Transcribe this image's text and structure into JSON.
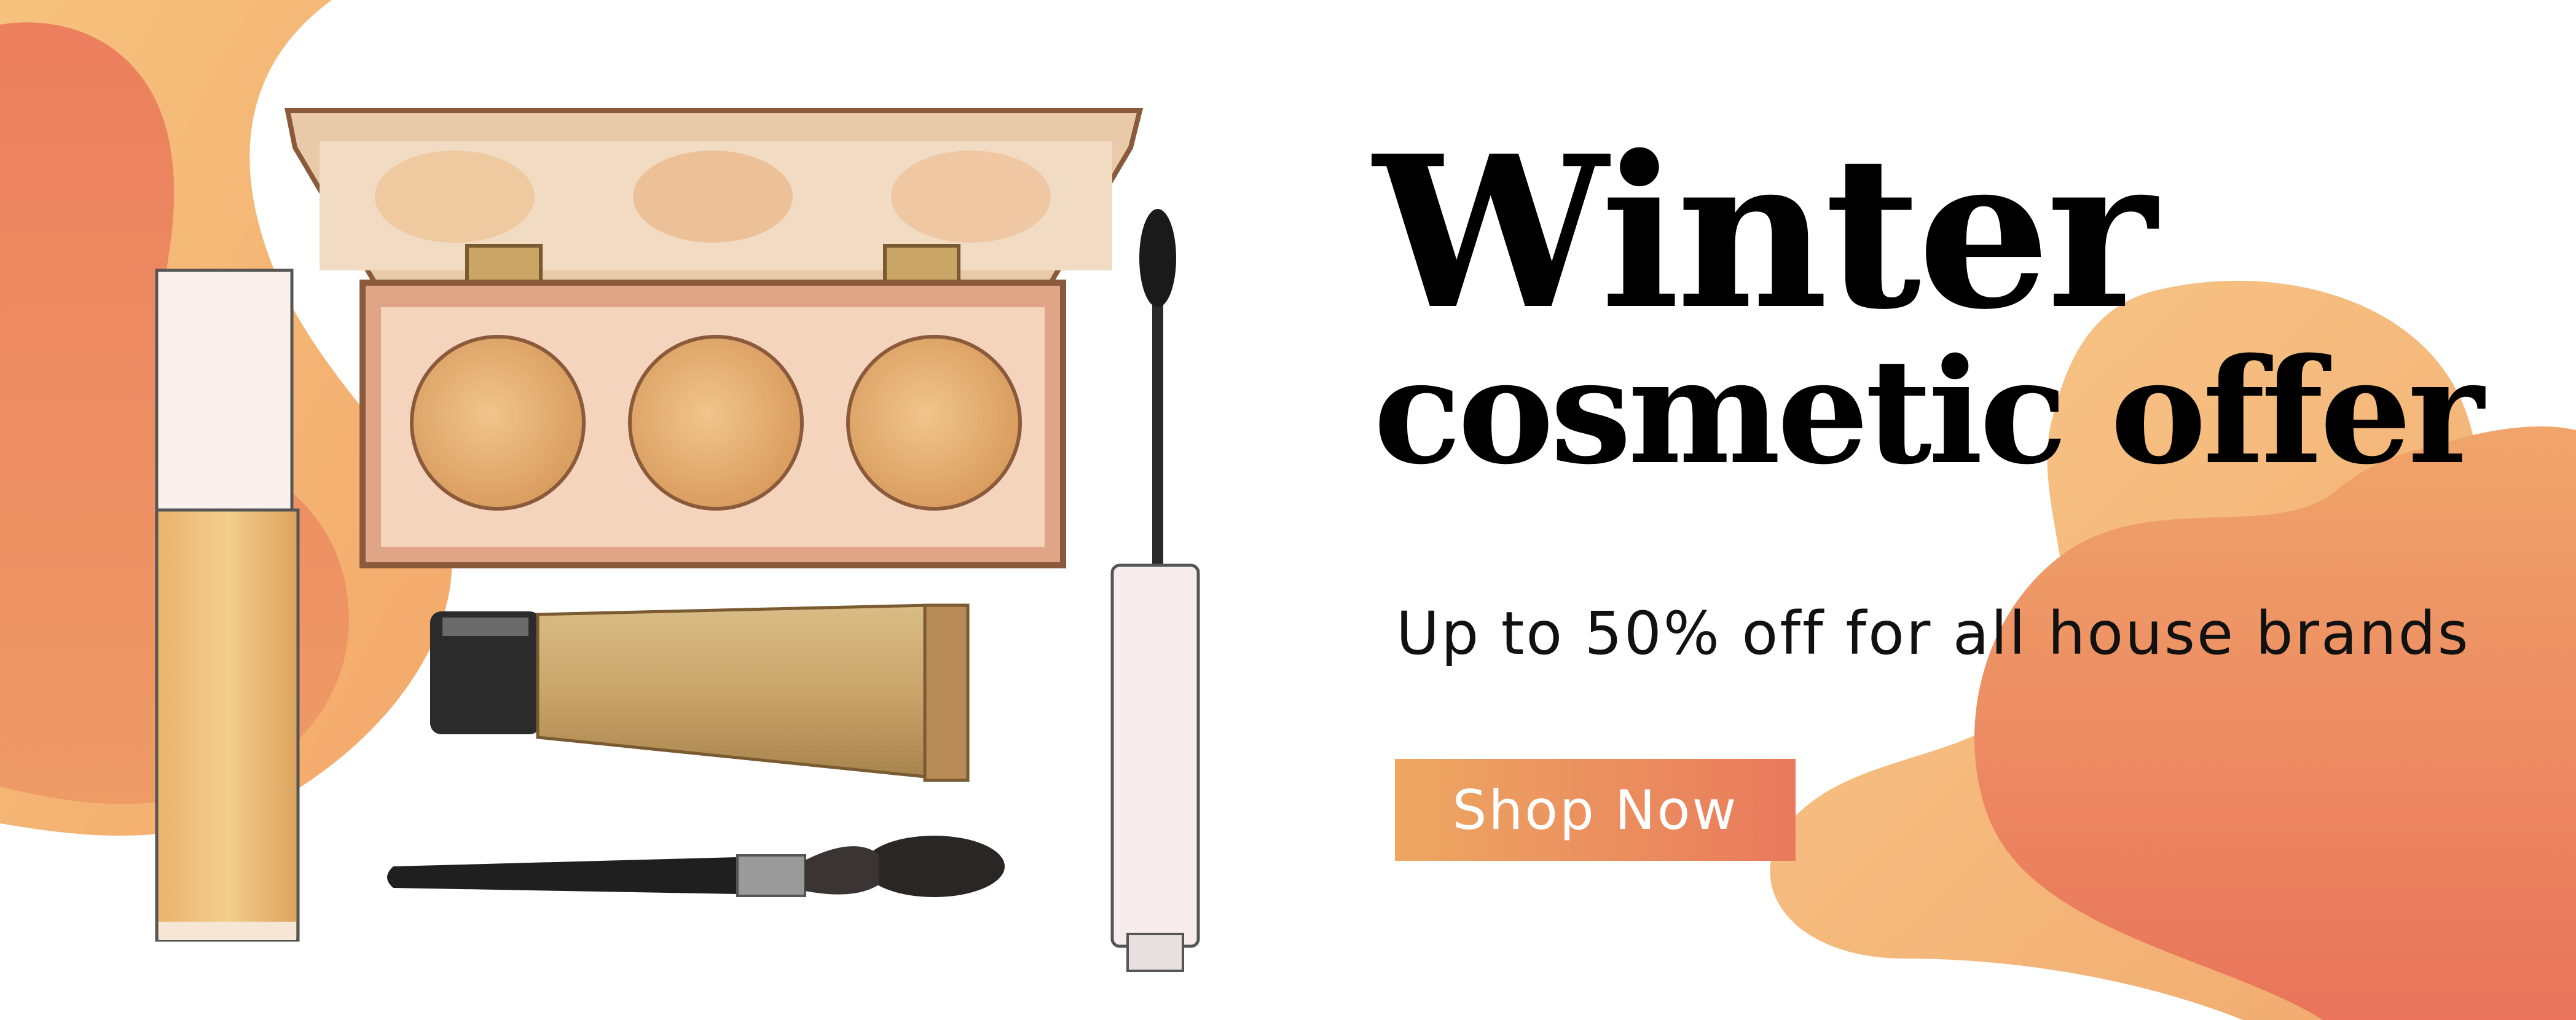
{
  "banner": {
    "headline_line1": "Winter",
    "headline_line2": "cosmetic offer",
    "subheadline": "Up to 50% off for all house brands",
    "cta_label": "Shop Now"
  },
  "colors": {
    "background": "#ffffff",
    "blob_light": "#f6c27e",
    "blob_dark": "#ec7f5e",
    "cta_start": "#eda762",
    "cta_end": "#e97a5c",
    "headline": "#000000"
  },
  "illustrations": [
    "eyeshadow-palette",
    "foundation-bottle",
    "concealer-tube",
    "makeup-brush",
    "mascara-wand"
  ]
}
